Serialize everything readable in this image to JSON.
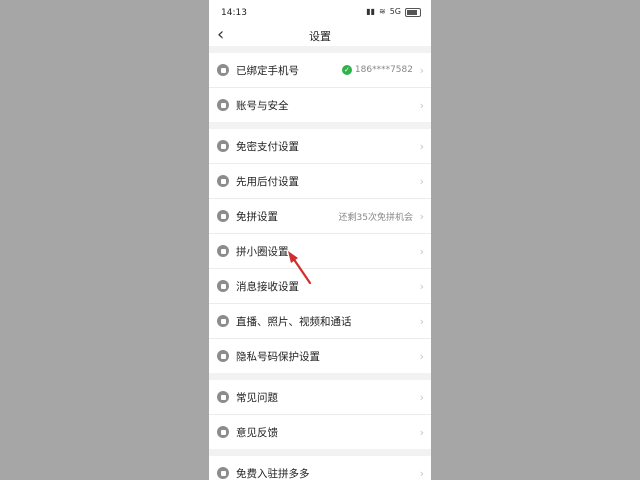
{
  "status_bar": {
    "time": "14:13",
    "signal_text": "5G",
    "wifi": "wifi-icon",
    "battery": "battery-icon"
  },
  "header": {
    "title": "设置"
  },
  "groups": [
    {
      "items": [
        {
          "label": "已绑定手机号",
          "icon": "phone-icon",
          "value": "186****7582",
          "verified": true
        },
        {
          "label": "账号与安全",
          "icon": "shield-icon"
        }
      ]
    },
    {
      "items": [
        {
          "label": "免密支付设置",
          "icon": "key-icon"
        },
        {
          "label": "先用后付设置",
          "icon": "clock-icon"
        },
        {
          "label": "免拼设置",
          "icon": "group-icon",
          "value": "还剩35次免拼机会"
        },
        {
          "label": "拼小圈设置",
          "icon": "circle-icon"
        },
        {
          "label": "消息接收设置",
          "icon": "message-icon"
        },
        {
          "label": "直播、照片、视频和通话",
          "icon": "camera-icon"
        },
        {
          "label": "隐私号码保护设置",
          "icon": "privacy-icon"
        }
      ]
    },
    {
      "items": [
        {
          "label": "常见问题",
          "icon": "question-icon"
        },
        {
          "label": "意见反馈",
          "icon": "edit-icon"
        }
      ]
    },
    {
      "items": [
        {
          "label": "免费入驻拼多多",
          "icon": "store-icon"
        }
      ]
    }
  ],
  "colors": {
    "annotation_arrow": "#d22d2d",
    "verified_badge": "#2fb24a"
  }
}
